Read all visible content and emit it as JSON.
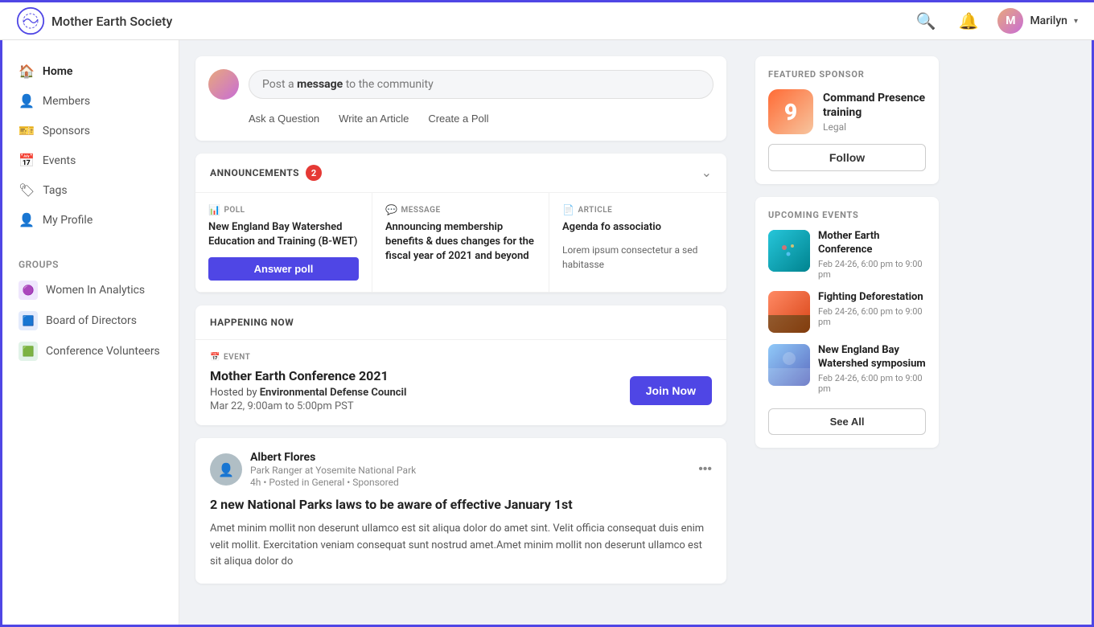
{
  "app": {
    "name": "Mother Earth Society",
    "user": {
      "name": "Marilyn",
      "avatar_initials": "M"
    }
  },
  "sidebar": {
    "nav_items": [
      {
        "id": "home",
        "label": "Home",
        "icon": "🏠",
        "active": true
      },
      {
        "id": "members",
        "label": "Members",
        "icon": "👤"
      },
      {
        "id": "sponsors",
        "label": "Sponsors",
        "icon": "🎫"
      },
      {
        "id": "events",
        "label": "Events",
        "icon": "📅"
      },
      {
        "id": "tags",
        "label": "Tags",
        "icon": "🏷"
      },
      {
        "id": "my-profile",
        "label": "My Profile",
        "icon": "👤"
      }
    ],
    "groups_title": "Groups",
    "groups": [
      {
        "id": "women-analytics",
        "label": "Women In Analytics",
        "color": "#7c3aed"
      },
      {
        "id": "board-directors",
        "label": "Board of Directors",
        "color": "#2563eb"
      },
      {
        "id": "conf-volunteers",
        "label": "Conference Volunteers",
        "color": "#16a34a"
      }
    ]
  },
  "post_box": {
    "placeholder_prefix": "Post a ",
    "placeholder_link": "message",
    "placeholder_suffix": " to the community",
    "actions": [
      {
        "id": "ask-question",
        "label": "Ask a Question"
      },
      {
        "id": "write-article",
        "label": "Write an Article"
      },
      {
        "id": "create-poll",
        "label": "Create a Poll"
      }
    ]
  },
  "announcements": {
    "title": "ANNOUNCEMENTS",
    "badge": "2",
    "items": [
      {
        "type": "POLL",
        "type_icon": "📊",
        "title": "New England Bay Watershed Education and Training (B-WET)",
        "action_label": "Answer poll"
      },
      {
        "type": "MESSAGE",
        "type_icon": "💬",
        "title": "Announcing membership benefits & dues changes for the fiscal year of 2021 and beyond"
      },
      {
        "type": "ARTICLE",
        "type_icon": "📄",
        "title": "Agenda fo associatio",
        "body": "Lorem ipsum consectetur a sed habitasse"
      }
    ]
  },
  "happening_now": {
    "section_title": "HAPPENING NOW",
    "event": {
      "type": "EVENT",
      "type_icon": "📅",
      "title": "Mother Earth Conference 2021",
      "host_prefix": "Hosted by ",
      "host": "Environmental Defense Council",
      "time": "Mar 22, 9:00am to 5:00pm PST",
      "cta": "Join Now"
    }
  },
  "post": {
    "author": {
      "name": "Albert Flores",
      "title": "Park Ranger at Yosemite National Park",
      "meta": "4h • Posted in General • Sponsored"
    },
    "headline": "2 new National Parks laws to be aware of effective January 1st",
    "body": "Amet minim mollit non deserunt ullamco est sit aliqua dolor do amet sint. Velit officia consequat duis enim velit mollit. Exercitation veniam consequat sunt nostrud amet.Amet minim mollit non deserunt ullamco est sit aliqua dolor do"
  },
  "right_panel": {
    "featured_sponsor": {
      "section_title": "FEATURED SPONSOR",
      "logo_number": "9",
      "name": "Command Presence training",
      "tag": "Legal",
      "follow_label": "Follow"
    },
    "upcoming_events": {
      "section_title": "UPCOMING EVENTS",
      "events": [
        {
          "name": "Mother Earth Conference",
          "date": "Feb 24-26, 6:00 pm to 9:00 pm",
          "img_class": "img-conference"
        },
        {
          "name": "Fighting Deforestation",
          "date": "Feb 24-26, 6:00 pm to 9:00 pm",
          "img_class": "img-deforestation"
        },
        {
          "name": "New England Bay Watershed symposium",
          "date": "Feb 24-26, 6:00 pm to 9:00 pm",
          "img_class": "img-watershed"
        }
      ],
      "see_all_label": "See All"
    }
  }
}
